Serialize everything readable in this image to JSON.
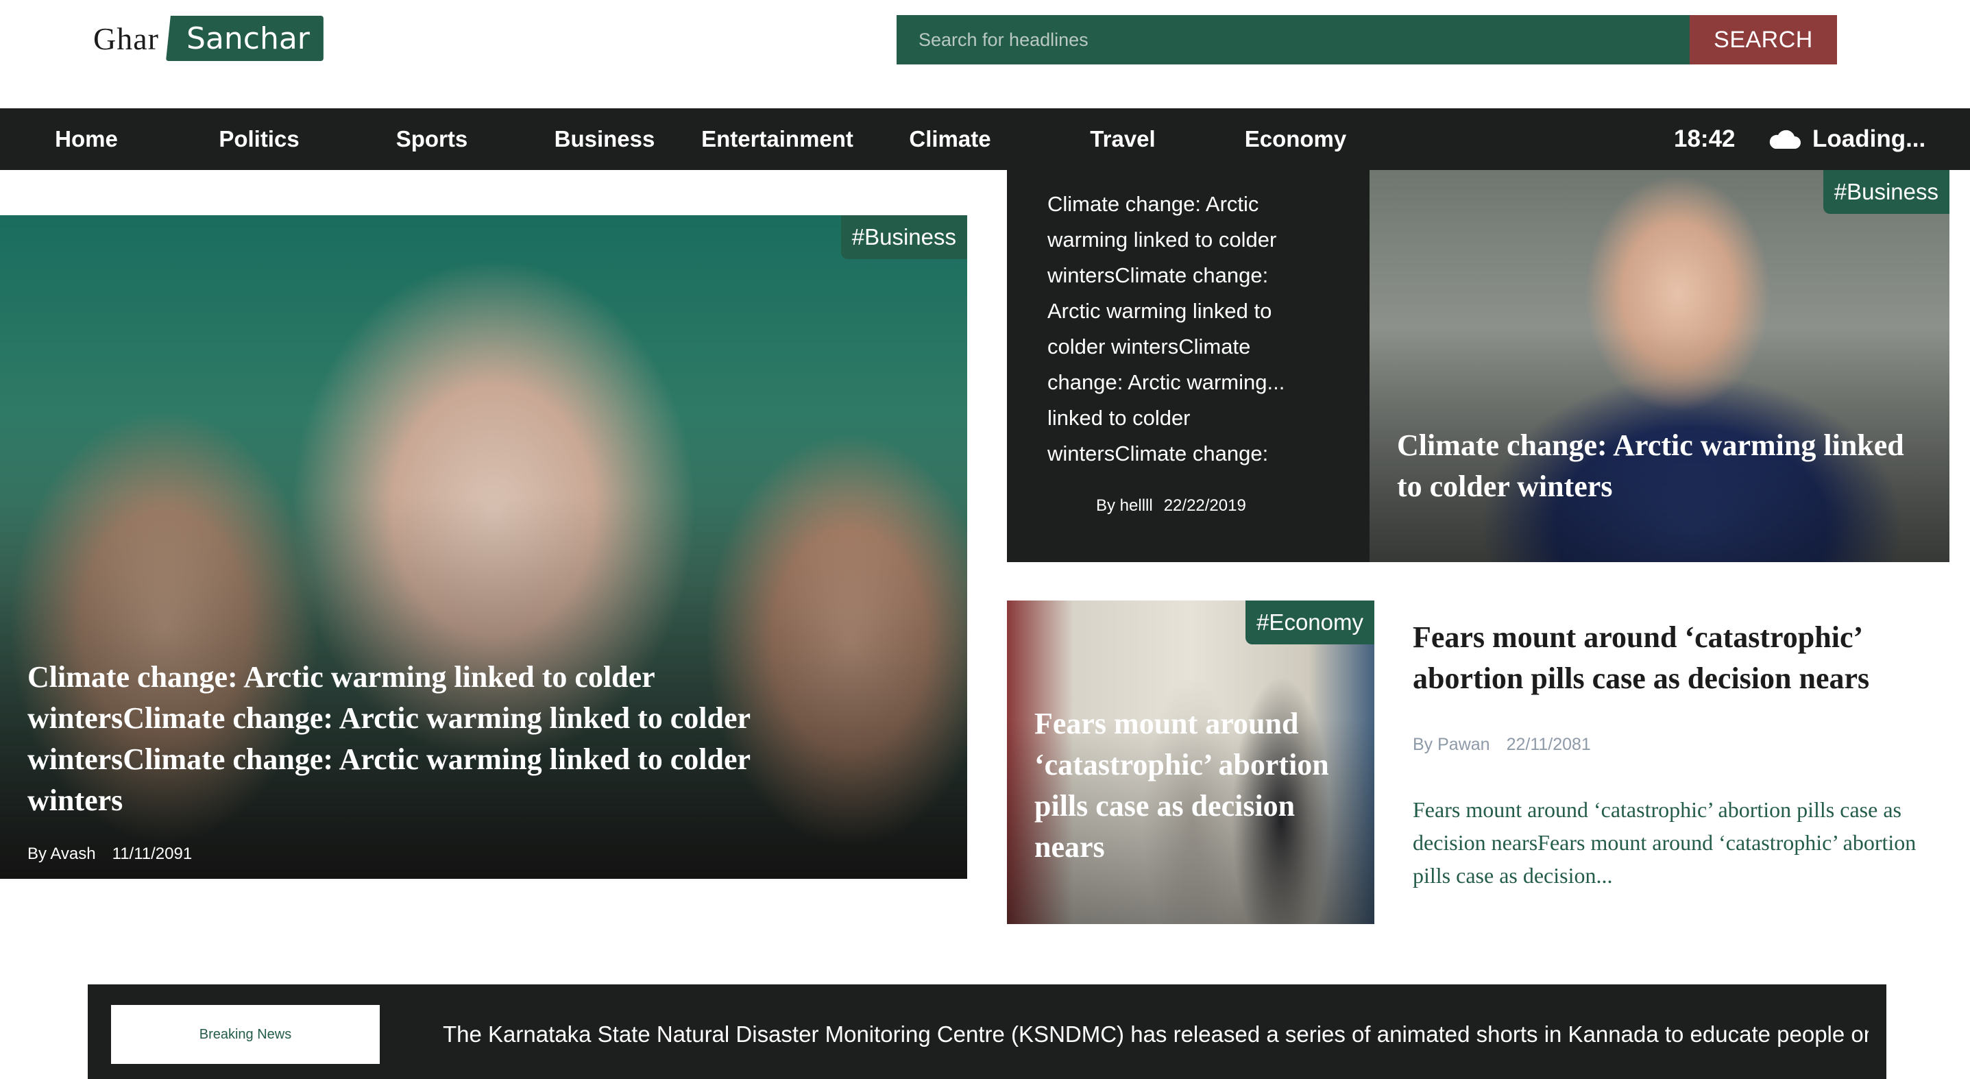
{
  "header": {
    "logo_left": "Ghar",
    "logo_right": "Sanchar",
    "search_placeholder": "Search for headlines",
    "search_button": "SEARCH"
  },
  "nav": {
    "items": [
      "Home",
      "Politics",
      "Sports",
      "Business",
      "Entertainment",
      "Climate",
      "Travel",
      "Economy"
    ],
    "time": "18:42",
    "weather_icon": "cloud-icon",
    "weather_text": "Loading..."
  },
  "feature": {
    "tag": "#Business",
    "title": "Climate change: Arctic warming linked to colder wintersClimate change: Arctic warming linked to colder wintersClimate change: Arctic warming linked to colder winters",
    "author": "By Avash",
    "date": "11/11/2091"
  },
  "text_card": {
    "body": "Climate change: Arctic warming linked to colder wintersClimate change: Arctic warming linked to colder wintersClimate change: Arctic warming... linked to colder wintersClimate change: Arctic warming linked to colder winters",
    "author": "By hellll",
    "date": "22/22/2019"
  },
  "image_card": {
    "tag": "#Business",
    "title": "Climate change: Arctic warming linked to colder winters"
  },
  "economy_card": {
    "tag": "#Economy",
    "title": "Fears mount around ‘catastrophic’ abortion pills case as decision nears"
  },
  "article": {
    "title": "Fears mount around ‘catastrophic’ abortion pills case as decision nears",
    "author": "By Pawan",
    "date": "22/11/2081",
    "excerpt": "Fears mount around ‘catastrophic’ abortion pills case as decision nearsFears mount around ‘catastrophic’ abortion pills case as decision..."
  },
  "breaking": {
    "label": "Breaking News",
    "text": "The Karnataka State Natural Disaster Monitoring Centre (KSNDMC) has released a series of animated shorts in Kannada to educate people on..."
  },
  "colors": {
    "brand_green": "#245c4a",
    "search_red": "#8e3b3c",
    "nav_dark": "#1d1e1e"
  }
}
